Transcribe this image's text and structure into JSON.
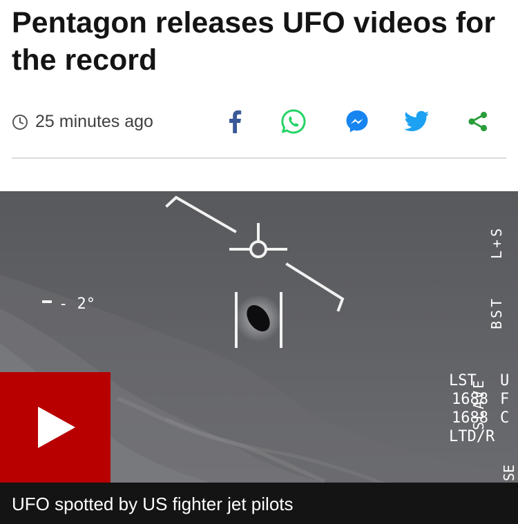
{
  "article": {
    "headline": "Pentagon releases UFO videos for the record",
    "timestamp": "25 minutes ago"
  },
  "share": {
    "icons": [
      "facebook-icon",
      "whatsapp-icon",
      "messenger-icon",
      "twitter-icon",
      "share-icon"
    ],
    "colors": {
      "facebook": "#3b5998",
      "whatsapp": "#25d366",
      "messenger": "#1685f0",
      "twitter": "#1da1f2",
      "share": "#2a9d3a"
    }
  },
  "media": {
    "caption": "UFO spotted by US fighter jet pilots",
    "play_color": "#b80000",
    "hud": {
      "angle": "- 2°",
      "right_col_1": "SLAVE",
      "right_col_2a": "L+S",
      "right_col_2b": "BST",
      "lst": "LST",
      "val1": "1688",
      "val2": "1688",
      "ltd": "LTD/R",
      "ufc_letters": [
        "U",
        "F",
        "C"
      ],
      "edge_text": "SE"
    }
  }
}
